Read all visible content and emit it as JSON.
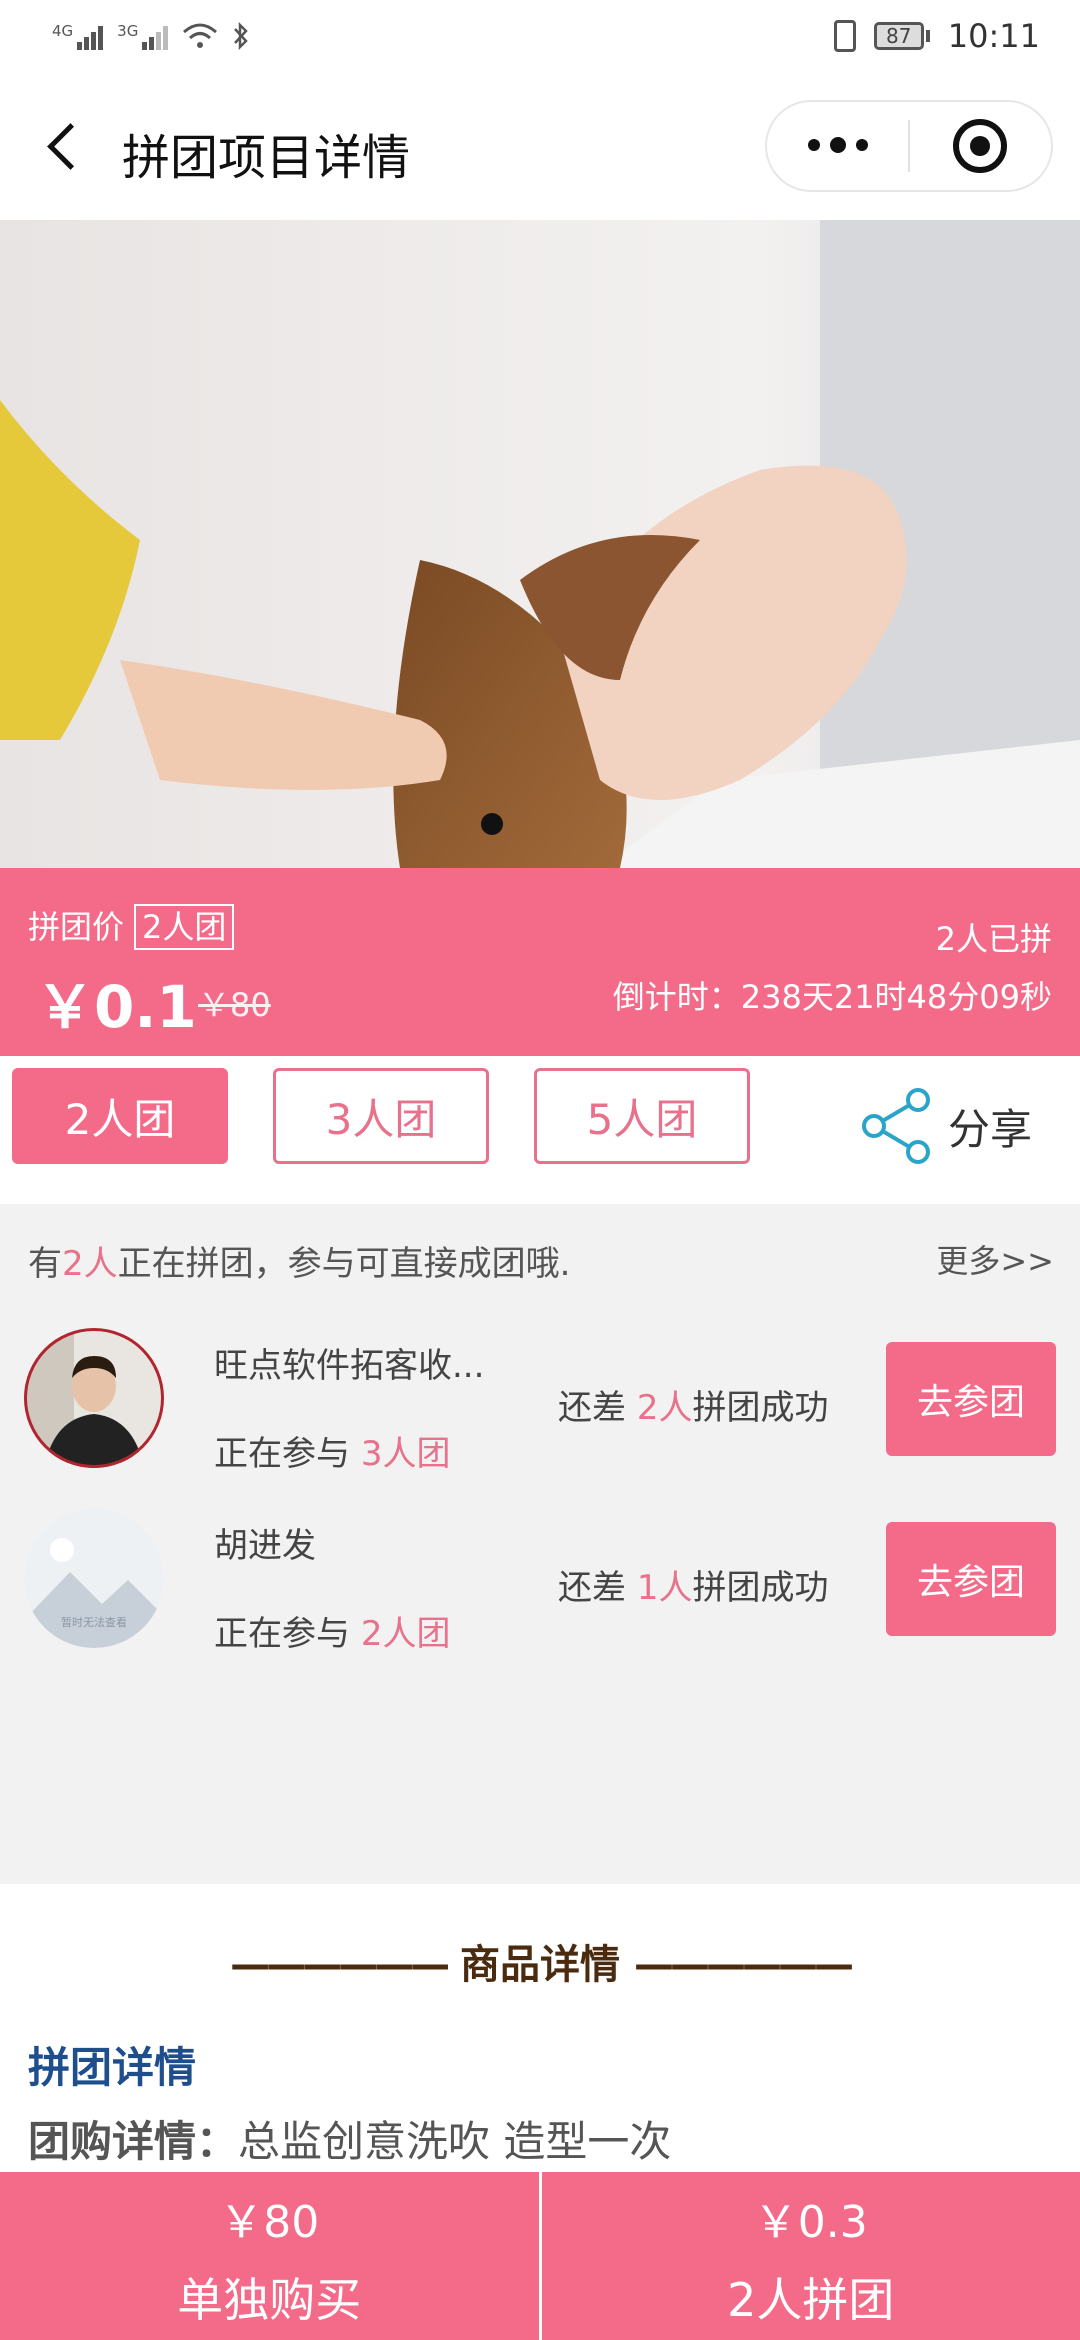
{
  "status_bar": {
    "network_1": "4G",
    "network_2": "3G",
    "battery": "87",
    "time": "10:11"
  },
  "nav": {
    "title": "拼团项目详情"
  },
  "price_bar": {
    "label": "拼团价",
    "group_tag": "2人团",
    "price": "￥0.1",
    "original_price": "￥80",
    "joined": "2人已拼",
    "countdown": "倒计时：238天21时48分09秒"
  },
  "tabs": [
    {
      "label": "2人团",
      "active": true
    },
    {
      "label": "3人团",
      "active": false
    },
    {
      "label": "5人团",
      "active": false
    }
  ],
  "share_label": "分享",
  "groups": {
    "head_prefix": "有",
    "head_count": "2人",
    "head_suffix": "正在拼团，参与可直接成团哦.",
    "more": "更多>>",
    "items": [
      {
        "name": "旺点软件拓客收...",
        "sub_prefix": "正在参与 ",
        "sub_group": "3人团",
        "need_prefix": "还差 ",
        "need_count": "2人",
        "need_suffix": "拼团成功",
        "button": "去参团"
      },
      {
        "name": "胡进发",
        "sub_prefix": "正在参与 ",
        "sub_group": "2人团",
        "need_prefix": "还差 ",
        "need_count": "1人",
        "need_suffix": "拼团成功",
        "button": "去参团",
        "avatar_text": "暂时无法查看"
      }
    ]
  },
  "detail": {
    "dash_left": "——————",
    "title": "商品详情",
    "dash_right": "——————",
    "subtitle": "拼团详情",
    "line_label": "团购详情：",
    "line_value": "总监创意洗吹 造型一次"
  },
  "bottom": {
    "solo_price": "￥80",
    "solo_label": "单独购买",
    "group_price": "￥0.3",
    "group_label": "2人拼团"
  },
  "colors": {
    "accent": "#f46b8a",
    "detail_title": "#4a2b0f",
    "subtitle_blue": "#1f4e8c"
  }
}
